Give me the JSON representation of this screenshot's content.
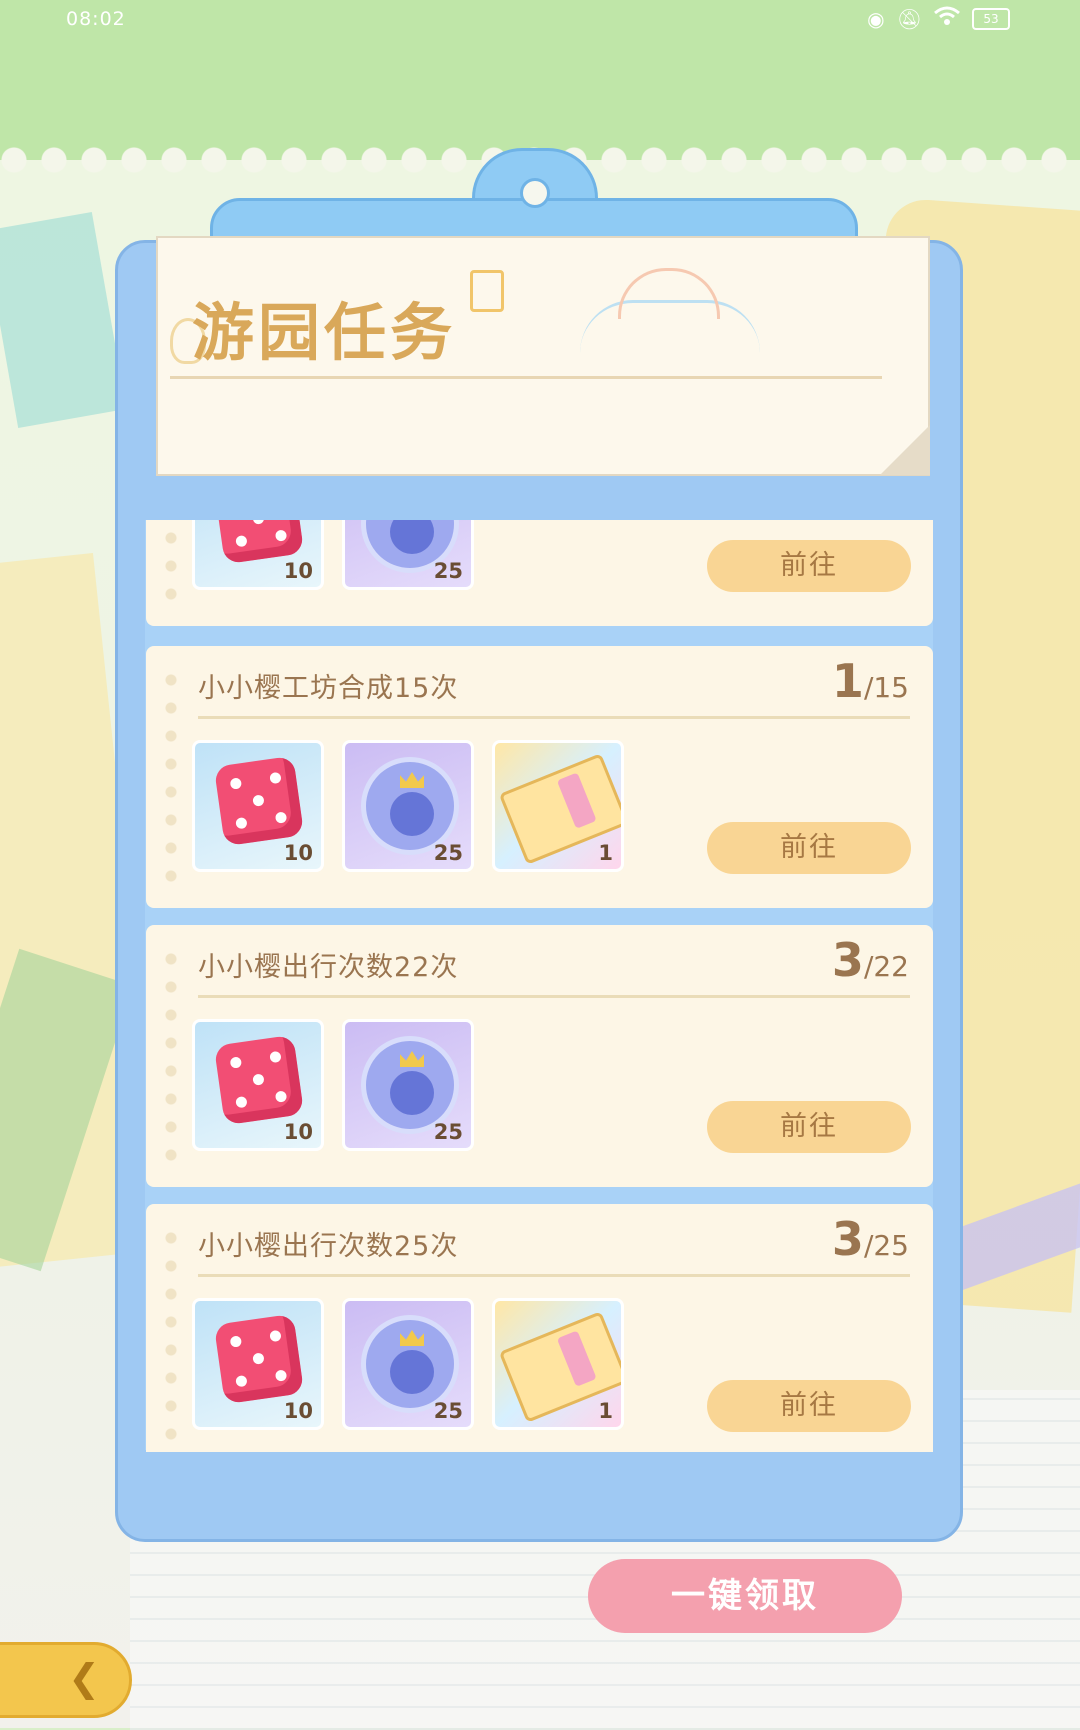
{
  "status_bar": {
    "time": "08:02",
    "battery": "53"
  },
  "header": {
    "title": "游园任务"
  },
  "tasks": [
    {
      "title": "",
      "current": "",
      "total": "",
      "rewards": [
        {
          "type": "dice",
          "count": "10"
        },
        {
          "type": "coin",
          "count": "25"
        }
      ],
      "button": "前往"
    },
    {
      "title": "小小樱工坊合成15次",
      "current": "1",
      "total": "/15",
      "rewards": [
        {
          "type": "dice",
          "count": "10"
        },
        {
          "type": "coin",
          "count": "25"
        },
        {
          "type": "ticket",
          "count": "1"
        }
      ],
      "button": "前往"
    },
    {
      "title": "小小樱出行次数22次",
      "current": "3",
      "total": "/22",
      "rewards": [
        {
          "type": "dice",
          "count": "10"
        },
        {
          "type": "coin",
          "count": "25"
        }
      ],
      "button": "前往"
    },
    {
      "title": "小小樱出行次数25次",
      "current": "3",
      "total": "/25",
      "rewards": [
        {
          "type": "dice",
          "count": "10"
        },
        {
          "type": "coin",
          "count": "25"
        },
        {
          "type": "ticket",
          "count": "1"
        }
      ],
      "button": "前往"
    }
  ],
  "footer": {
    "claim_all": "一键领取"
  },
  "icons": {
    "back": "back-arrow-icon",
    "eye": "eye-icon",
    "mute": "bell-muted-icon",
    "wifi": "wifi-icon"
  },
  "colors": {
    "accent_pink": "#f4a0ae",
    "button_orange": "#f9d594",
    "board_blue": "#9fc9f3"
  }
}
